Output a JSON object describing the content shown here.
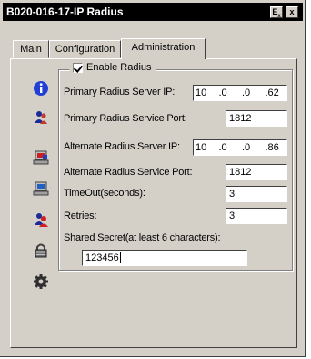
{
  "window": {
    "title": "B020-016-17-IP Radius",
    "help_label": "E",
    "close_label": "x"
  },
  "tabs": [
    {
      "label": "Main"
    },
    {
      "label": "Configuration"
    },
    {
      "label": "Administration"
    }
  ],
  "sidebar_icons": [
    {
      "icon": "info-icon"
    },
    {
      "icon": "user-group-icon"
    },
    {
      "icon": "computer-red-icon"
    },
    {
      "icon": "computer-blue-icon"
    },
    {
      "icon": "user-red-icon"
    },
    {
      "icon": "lock-icon"
    },
    {
      "icon": "gear-icon"
    }
  ],
  "radius": {
    "enable_label": "Enable Radius",
    "enabled": true,
    "primary_ip_label": "Primary Radius Server IP:",
    "primary_ip": [
      "10",
      ".0",
      ".0",
      ".62"
    ],
    "primary_port_label": "Primary Radius Service Port:",
    "primary_port": "1812",
    "alternate_ip_label": "Alternate Radius Server IP:",
    "alternate_ip": [
      "10",
      ".0",
      ".0",
      ".86"
    ],
    "alternate_port_label": "Alternate Radius Service Port:",
    "alternate_port": "1812",
    "timeout_label": "TimeOut(seconds):",
    "timeout": "3",
    "retries_label": "Retries:",
    "retries": "3",
    "secret_label": "Shared Secret(at least 6 characters):",
    "secret": "123456"
  },
  "colors": {
    "face": "#d4d0c8",
    "titlebar": "#000000",
    "info_blue": "#0000cc"
  }
}
